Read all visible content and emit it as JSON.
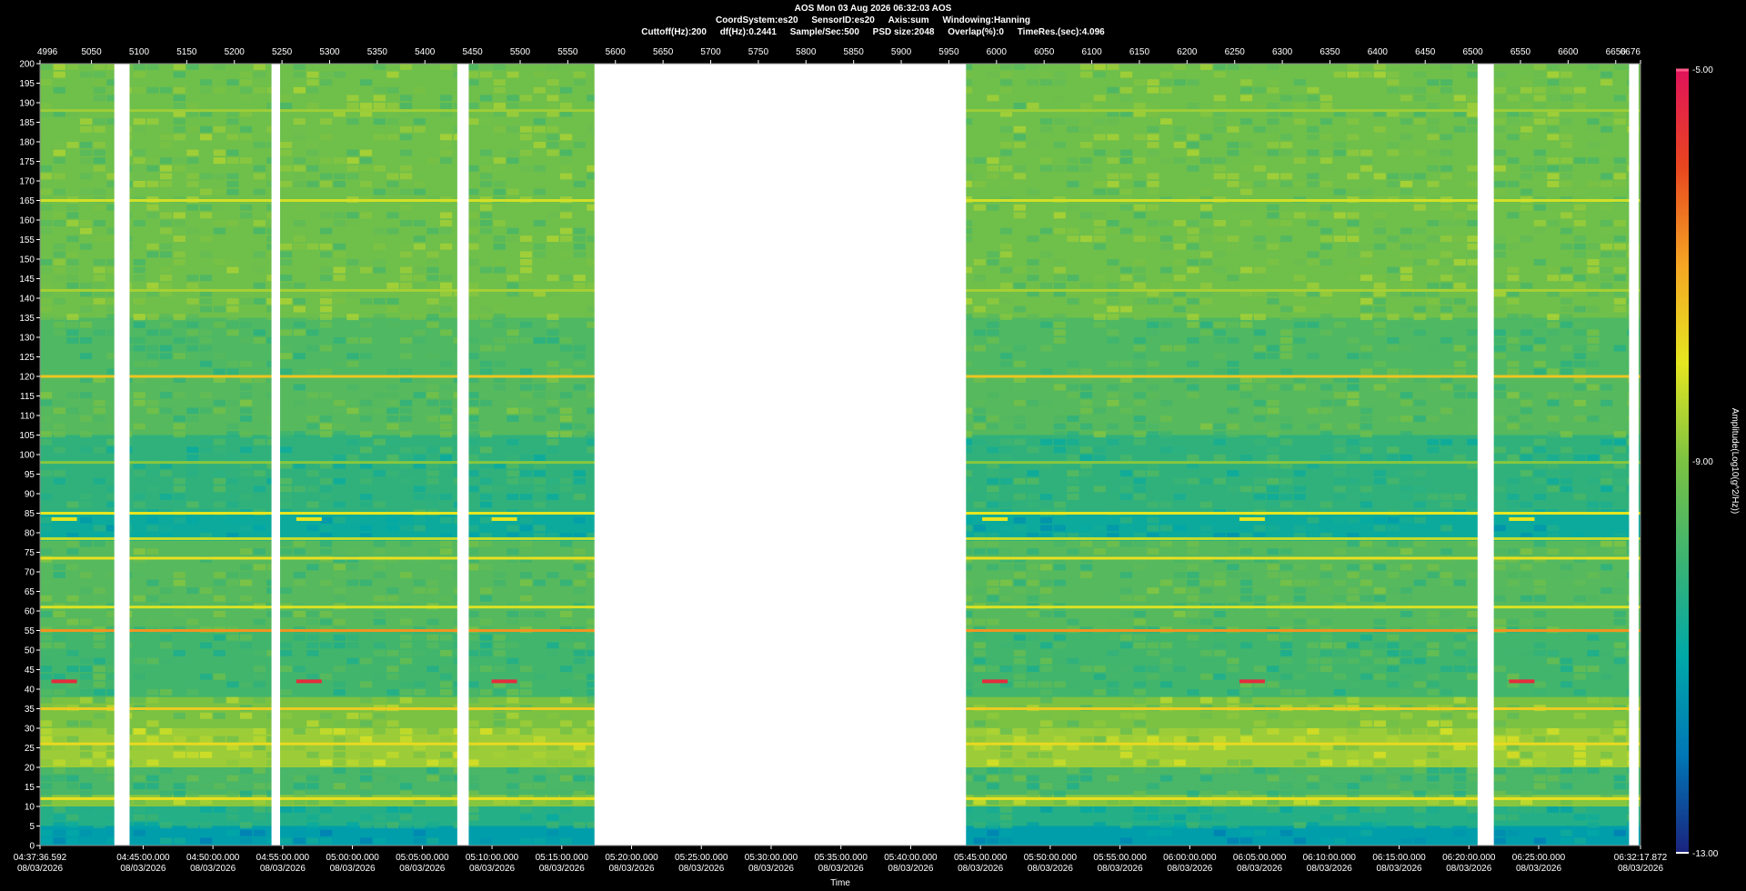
{
  "header": {
    "line1": "AOS  Mon 03 Aug 2026 06:32:03  AOS",
    "line2": [
      "CoordSystem:es20",
      "SensorID:es20",
      "Axis:sum",
      "Windowing:Hanning"
    ],
    "line3": [
      "Cuttoff(Hz):200",
      "df(Hz):0.2441",
      "Sample/Sec:500",
      "PSD size:2048",
      "Overlap(%):0",
      "TimeRes.(sec):4.096"
    ]
  },
  "chart_data": {
    "type": "heatmap",
    "title": "AOS  Mon 03 Aug 2026 06:32:03  AOS",
    "xlabel": "Time",
    "ylabel": "",
    "colorbar_label": "Amplitude(Log10(g^2/Hz))",
    "colorbar_ticks": [
      "-5.00",
      "-9.00",
      "-13.00"
    ],
    "colorbar_range": [
      -13,
      -5
    ],
    "colorscale": [
      "#1a237e",
      "#0077b6",
      "#00a8a8",
      "#3cb371",
      "#7cc242",
      "#e6e620",
      "#f5a623",
      "#e8461f",
      "#e0125a"
    ],
    "ylim": [
      0,
      200
    ],
    "y_ticks": [
      200,
      195,
      190,
      185,
      180,
      175,
      170,
      165,
      160,
      155,
      150,
      145,
      140,
      135,
      130,
      125,
      120,
      115,
      110,
      105,
      100,
      95,
      90,
      85,
      80,
      75,
      70,
      65,
      60,
      55,
      50,
      45,
      40,
      35,
      30,
      25,
      20,
      15,
      10,
      5,
      0
    ],
    "top_axis_range": [
      4996,
      6676
    ],
    "top_ticks": [
      "4996",
      "5050",
      "5100",
      "5150",
      "5200",
      "5250",
      "5300",
      "5350",
      "5400",
      "5450",
      "5500",
      "5550",
      "5600",
      "5650",
      "5700",
      "5750",
      "5800",
      "5850",
      "5900",
      "5950",
      "6000",
      "6050",
      "6100",
      "6150",
      "6200",
      "6250",
      "6300",
      "6350",
      "6400",
      "6450",
      "6500",
      "6550",
      "6600",
      "6650",
      "6676"
    ],
    "x_range": [
      "04:37:36.592",
      "06:32:17.872"
    ],
    "time_ticks": [
      {
        "time": "04:37:36.592",
        "date": "08/03/2026"
      },
      {
        "time": "04:45:00.000",
        "date": "08/03/2026"
      },
      {
        "time": "04:50:00.000",
        "date": "08/03/2026"
      },
      {
        "time": "04:55:00.000",
        "date": "08/03/2026"
      },
      {
        "time": "05:00:00.000",
        "date": "08/03/2026"
      },
      {
        "time": "05:05:00.000",
        "date": "08/03/2026"
      },
      {
        "time": "05:10:00.000",
        "date": "08/03/2026"
      },
      {
        "time": "05:15:00.000",
        "date": "08/03/2026"
      },
      {
        "time": "05:20:00.000",
        "date": "08/03/2026"
      },
      {
        "time": "05:25:00.000",
        "date": "08/03/2026"
      },
      {
        "time": "05:30:00.000",
        "date": "08/03/2026"
      },
      {
        "time": "05:35:00.000",
        "date": "08/03/2026"
      },
      {
        "time": "05:40:00.000",
        "date": "08/03/2026"
      },
      {
        "time": "05:45:00.000",
        "date": "08/03/2026"
      },
      {
        "time": "05:50:00.000",
        "date": "08/03/2026"
      },
      {
        "time": "05:55:00.000",
        "date": "08/03/2026"
      },
      {
        "time": "06:00:00.000",
        "date": "08/03/2026"
      },
      {
        "time": "06:05:00.000",
        "date": "08/03/2026"
      },
      {
        "time": "06:10:00.000",
        "date": "08/03/2026"
      },
      {
        "time": "06:15:00.000",
        "date": "08/03/2026"
      },
      {
        "time": "06:20:00.000",
        "date": "08/03/2026"
      },
      {
        "time": "06:25:00.000",
        "date": "08/03/2026"
      },
      {
        "time": "06:32:17.872",
        "date": "08/03/2026"
      }
    ],
    "data_gaps_top_axis": [
      [
        5074,
        5090
      ],
      [
        5239,
        5248
      ],
      [
        5434,
        5446
      ],
      [
        5578,
        5968
      ],
      [
        6505,
        6522
      ],
      [
        6664,
        6674
      ]
    ],
    "frequency_bands": [
      {
        "y_range": [
          0,
          5
        ],
        "level": -11.2
      },
      {
        "y_range": [
          5,
          10
        ],
        "level": -10.4
      },
      {
        "y_range": [
          10,
          13
        ],
        "level": -8.9
      },
      {
        "y_range": [
          13,
          20
        ],
        "level": -9.8
      },
      {
        "y_range": [
          20,
          30
        ],
        "level": -8.7
      },
      {
        "y_range": [
          30,
          38
        ],
        "level": -9.0
      },
      {
        "y_range": [
          38,
          55
        ],
        "level": -9.9
      },
      {
        "y_range": [
          55,
          78
        ],
        "level": -9.6
      },
      {
        "y_range": [
          78,
          85
        ],
        "level": -10.8
      },
      {
        "y_range": [
          85,
          105
        ],
        "level": -10.2
      },
      {
        "y_range": [
          105,
          120
        ],
        "level": -9.6
      },
      {
        "y_range": [
          120,
          135
        ],
        "level": -9.7
      },
      {
        "y_range": [
          135,
          200
        ],
        "level": -9.2
      }
    ],
    "tonal_lines": [
      {
        "freq": 120,
        "level": -7.5
      },
      {
        "freq": 165,
        "level": -8.2
      },
      {
        "freq": 142,
        "level": -8.6
      },
      {
        "freq": 188,
        "level": -8.7
      },
      {
        "freq": 98,
        "level": -8.9
      },
      {
        "freq": 85,
        "level": -8.0
      },
      {
        "freq": 78.5,
        "level": -8.3
      },
      {
        "freq": 73.5,
        "level": -7.9
      },
      {
        "freq": 61,
        "level": -8.1
      },
      {
        "freq": 55,
        "level": -6.8
      },
      {
        "freq": 35,
        "level": -7.6
      },
      {
        "freq": 26,
        "level": -7.8
      },
      {
        "freq": 12,
        "level": -7.9
      }
    ],
    "event_markers": [
      {
        "freq": 42,
        "level": -5.5
      },
      {
        "freq": 83.5,
        "level": -8.0
      }
    ]
  }
}
